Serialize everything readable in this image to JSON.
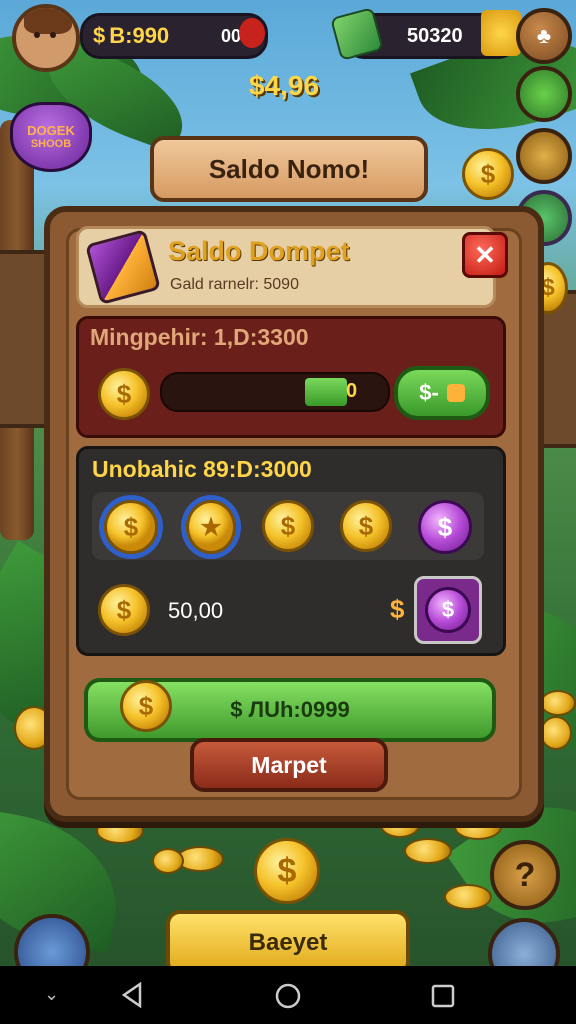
{
  "top_bar": {
    "currency_amount": "B:990",
    "currency_suffix": "00",
    "cash_amount": "50320",
    "balance_text": "$4,96"
  },
  "shop_badge": {
    "line1": "DOGEK",
    "line2": "SHOOB"
  },
  "title_banner": "Saldo Nomo!",
  "panel": {
    "title": "Saldo Dompet",
    "subtitle": "Gald rarnelr: 5090",
    "section1": {
      "label": "Mingpehir: 1,D:3300",
      "bar_value": "0",
      "bar_fill_fraction": 0.82,
      "button_label": "$-"
    },
    "section2": {
      "label": "Unobahic 89:D:3000",
      "amount": "50,00"
    },
    "primary_button": "$ ЛUh:0999",
    "secondary_button": "Marpet"
  },
  "bottom_button": "Baeyet",
  "help_icon": "?",
  "colors": {
    "panel_wood": "#8b5a33",
    "red_section": "#6b1f1a",
    "dark_section": "#2f2d2b",
    "green": "#5cbf3a",
    "gold": "#f5c22a"
  }
}
